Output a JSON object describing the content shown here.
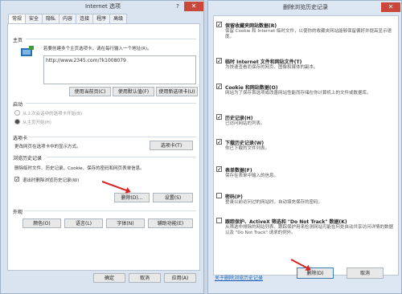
{
  "left": {
    "title": "Internet 选项",
    "help": "?",
    "close": "✕",
    "tabs": [
      "常规",
      "安全",
      "隐私",
      "内容",
      "连接",
      "程序",
      "高级"
    ],
    "home": {
      "heading": "主页",
      "hint": "若要创建多个主页选项卡，请在每行输入一个地址(R)。",
      "url": "http://www.2345.com/?k1008079",
      "buttons": [
        "使用当前页(C)",
        "使用默认值(F)",
        "使用新选项卡(U)"
      ]
    },
    "startup": {
      "heading": "启动",
      "option1": "从上次会话中的选项卡开始(B)",
      "option2": "从主页开始(H)"
    },
    "tabsec": {
      "heading": "选项卡",
      "desc": "更改网页在选项卡中的显示方式。",
      "button": "选项卡(T)"
    },
    "history": {
      "heading": "浏览历史记录",
      "desc": "删除临时文件、历史记录、Cookie、保存的密码和网页表单信息。",
      "checkbox": "退出时删除浏览历史记录(W)",
      "delete_button": "删除(D)...",
      "settings_button": "设置(S)"
    },
    "appearance": {
      "heading": "外观",
      "buttons": [
        "颜色(O)",
        "语言(L)",
        "字体(N)",
        "辅助功能(E)"
      ]
    },
    "bottom_buttons": [
      "确定",
      "取消",
      "应用(A)"
    ]
  },
  "right": {
    "title": "删除浏览历史记录",
    "close": "✕",
    "options": [
      {
        "title": "保留收藏夹网站数据(R)",
        "desc": "保留 Cookie 和 Internet 临时文件，以使你的收藏夹网站能够保留偏好并提高显示速度。",
        "checked": true
      },
      {
        "title": "临时 Internet 文件和网站文件(T)",
        "desc": "为快速查看而保存的网页、图像和媒体的副本。",
        "checked": true
      },
      {
        "title": "Cookie 和网站数据(O)",
        "desc": "网站为了保存首选项或改善网站性能而存储在你计算机上的文件或数据库。",
        "checked": true
      },
      {
        "title": "历史记录(H)",
        "desc": "已访问网站的列表。",
        "checked": true
      },
      {
        "title": "下载历史记录(W)",
        "desc": "你已下载的文件列表。",
        "checked": true
      },
      {
        "title": "表单数据(F)",
        "desc": "保存在表单中输入的信息。",
        "checked": true
      },
      {
        "title": "密码(P)",
        "desc": "登录以前访问过的网站时，自动填充保存的密码。",
        "checked": false
      },
      {
        "title": "跟踪保护、ActiveX 筛选和 \"Do Not Track\" 数据(K)",
        "desc": "从筛选中排除的网站列表、跟踪保护用来检测网站可能在何处自动共享访问详情的数据以及 \"Do Not Track\" 请求的例外。",
        "checked": false
      }
    ],
    "about_link": "关于删除浏览历史记录",
    "delete_button": "删除(D)",
    "cancel_button": "取消"
  },
  "colors": {
    "accent": "#3c7fb1",
    "close": "#c9483b",
    "arrow": "#dd2222"
  }
}
